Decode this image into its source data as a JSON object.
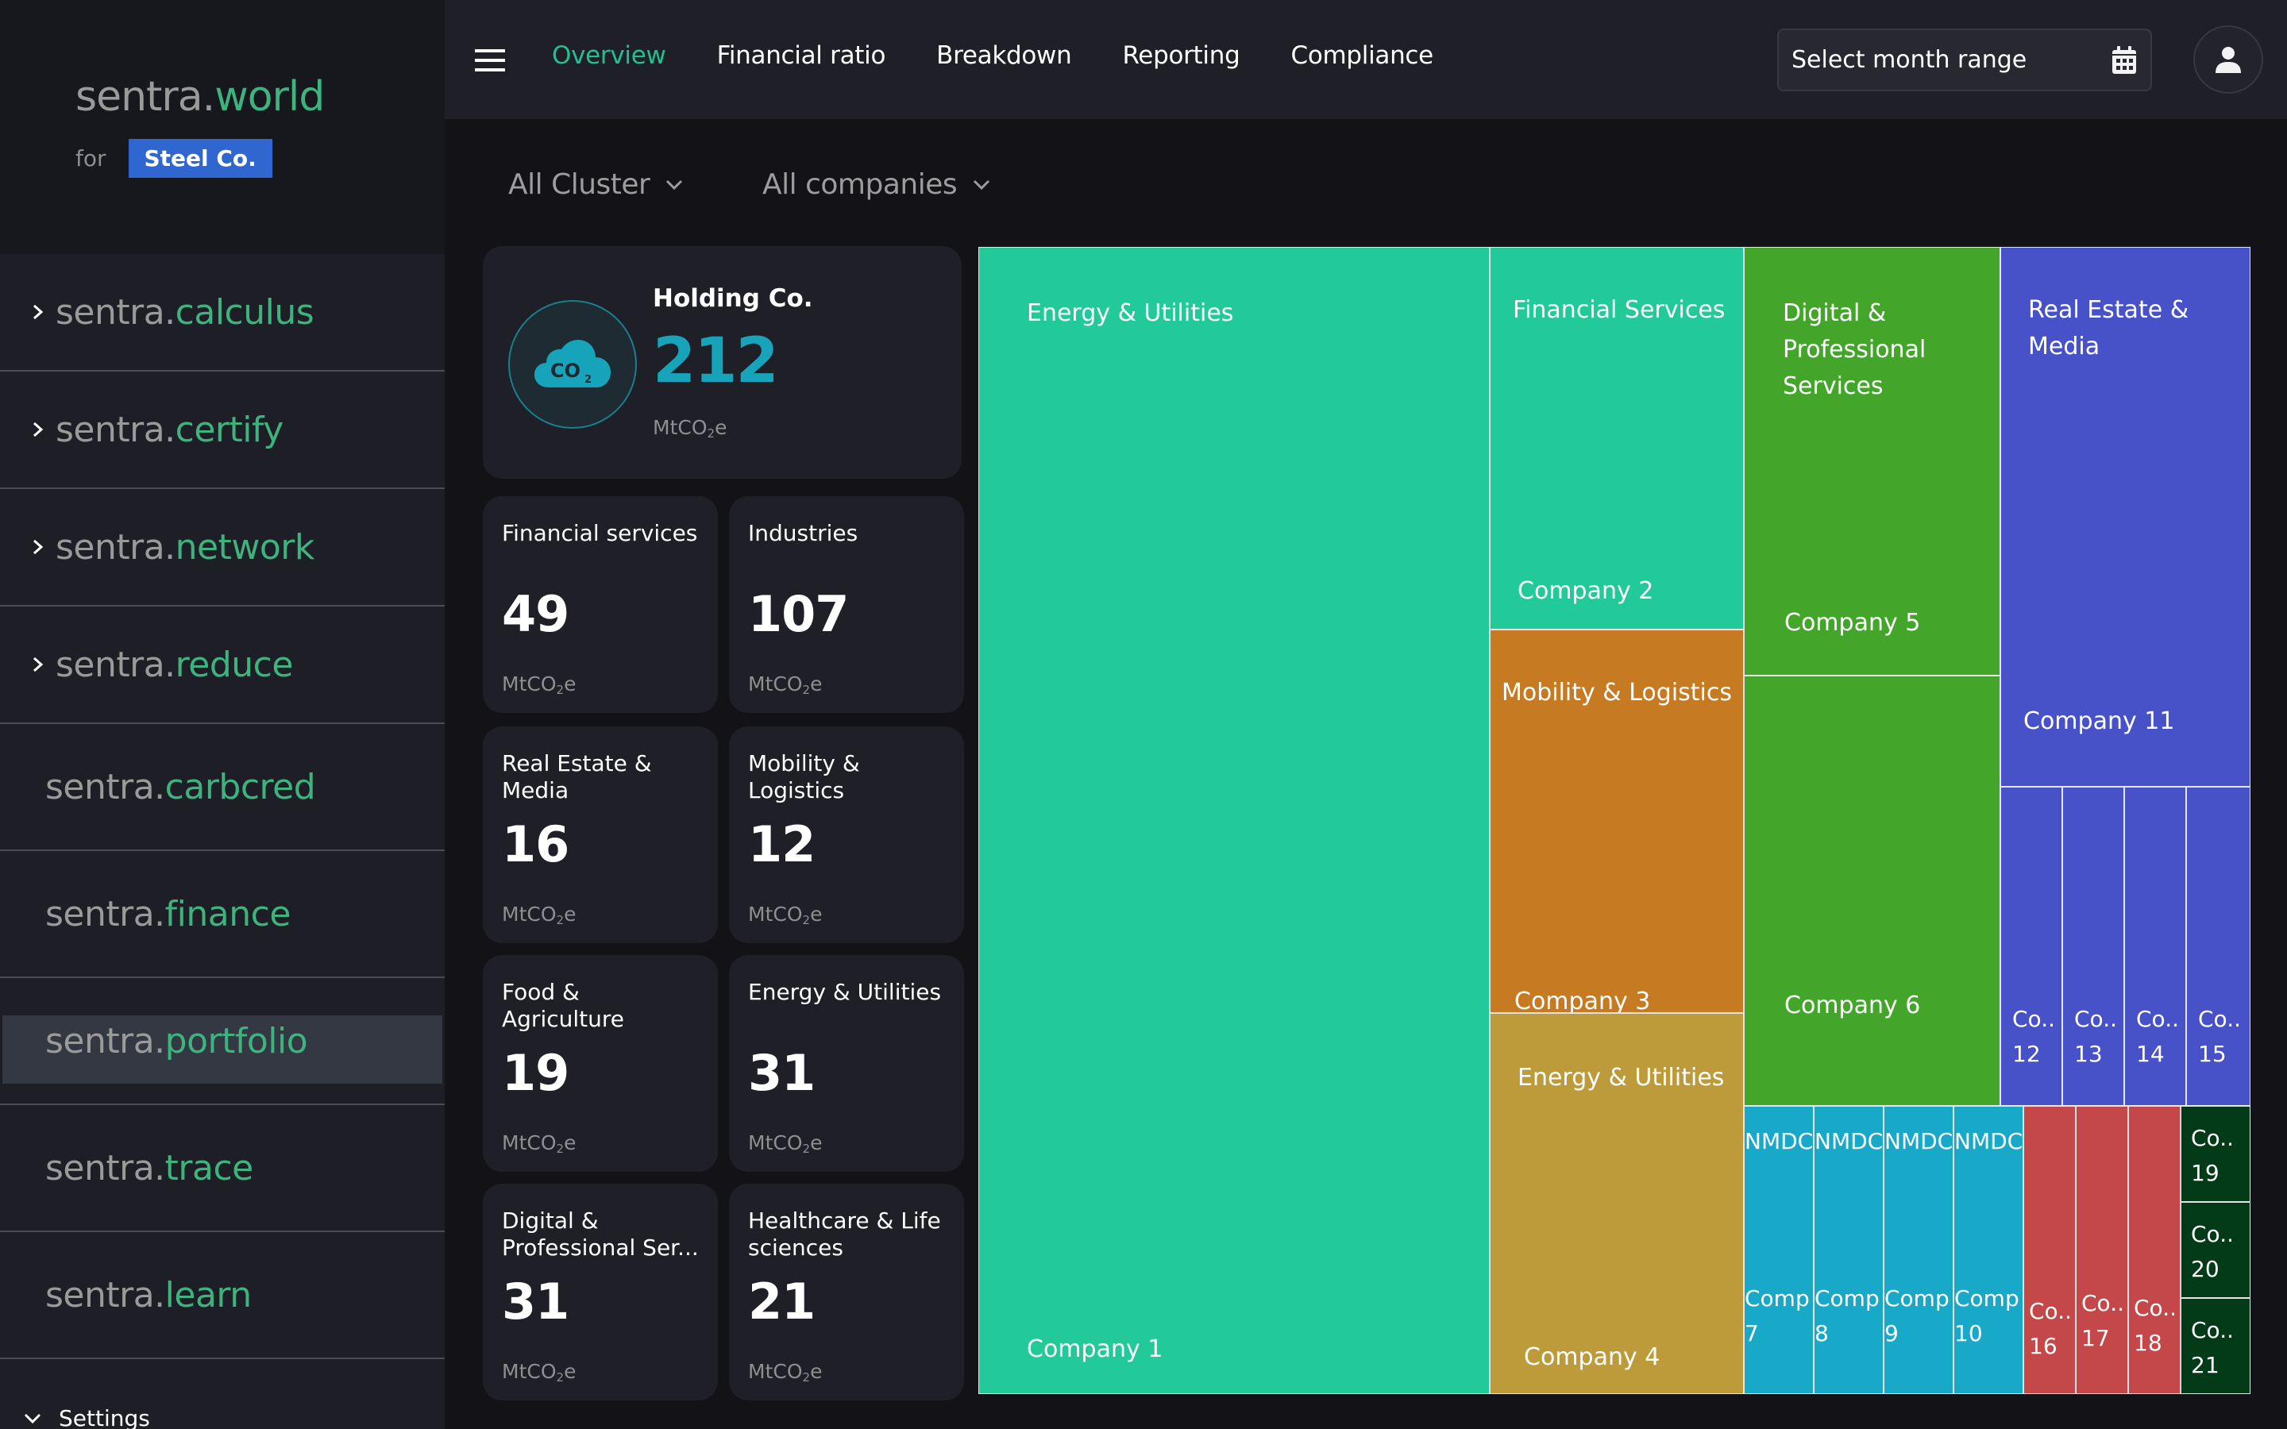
{
  "brand": {
    "prefix": "sentra.",
    "suffix": "world",
    "for_label": "for",
    "client": "Steel Co."
  },
  "sidebar": {
    "items": [
      {
        "prefix": "sentra.",
        "suffix": "calculus",
        "expandable": true
      },
      {
        "prefix": "sentra.",
        "suffix": "certify",
        "expandable": true
      },
      {
        "prefix": "sentra.",
        "suffix": "network",
        "expandable": true
      },
      {
        "prefix": "sentra.",
        "suffix": "reduce",
        "expandable": true
      },
      {
        "prefix": "sentra.",
        "suffix": "carbcred",
        "expandable": false
      },
      {
        "prefix": "sentra.",
        "suffix": "finance",
        "expandable": false
      },
      {
        "prefix": "sentra.",
        "suffix": "portfolio",
        "expandable": false,
        "active": true
      },
      {
        "prefix": "sentra.",
        "suffix": "trace",
        "expandable": false
      },
      {
        "prefix": "sentra.",
        "suffix": "learn",
        "expandable": false
      }
    ],
    "settings_label": "Settings"
  },
  "topbar": {
    "tabs": [
      {
        "label": "Overview",
        "active": true
      },
      {
        "label": "Financial ratio"
      },
      {
        "label": "Breakdown"
      },
      {
        "label": "Reporting"
      },
      {
        "label": "Compliance"
      }
    ],
    "month_range_placeholder": "Select month range",
    "icons": {
      "menu": "hamburger-icon",
      "calendar": "calendar-icon",
      "user": "user-icon"
    }
  },
  "filters": {
    "cluster": "All Cluster",
    "companies": "All companies"
  },
  "colors": {
    "accent": "#22c08f",
    "brand_green": "#3db37e",
    "client_badge": "#2f66d0",
    "holding_value": "#17a3ba"
  },
  "holding": {
    "title": "Holding Co.",
    "value": "212",
    "unit_pre": "MtCO",
    "unit_sub": "2",
    "unit_post": "e",
    "icon": "co2-cloud-icon"
  },
  "sectors": [
    {
      "name": "Financial services",
      "value": "49"
    },
    {
      "name": "Industries",
      "value": "107"
    },
    {
      "name": "Real Estate & Media",
      "value": "16"
    },
    {
      "name": "Mobility & Logistics",
      "value": "12"
    },
    {
      "name": "Food & Agriculture",
      "value": "19"
    },
    {
      "name": "Energy & Utilities",
      "value": "31"
    },
    {
      "name": "Digital & Professional Ser...",
      "value": "31"
    },
    {
      "name": "Healthcare & Life sciences",
      "value": "21"
    }
  ],
  "chart_data": {
    "type": "treemap",
    "title": "",
    "tiles": [
      {
        "sector": "Energy & Utilities",
        "company": "Company 1",
        "color": "#22c999"
      },
      {
        "sector": "Financial Services",
        "company": "Company 2",
        "color": "#22c999"
      },
      {
        "sector": "Mobility & Logistics",
        "company": "Company 3",
        "color": "#c67a22"
      },
      {
        "sector": "Energy & Utilities",
        "company": "Company 4",
        "color": "#bd9b3a"
      },
      {
        "sector": "Digital & Professional Services",
        "company": "Company 5",
        "color": "#43a62b"
      },
      {
        "sector": "",
        "company": "Company 6",
        "color": "#43a62b"
      },
      {
        "sector": "NMDC",
        "company": "Comp 7",
        "color": "#18a8c8"
      },
      {
        "sector": "NMDC",
        "company": "Comp 8",
        "color": "#18a8c8"
      },
      {
        "sector": "NMDC",
        "company": "Comp 9",
        "color": "#18a8c8"
      },
      {
        "sector": "NMDC",
        "company": "Comp 10",
        "color": "#18a8c8"
      },
      {
        "sector": "Real Estate & Media",
        "company": "Company 11",
        "color": "#4752c8"
      },
      {
        "sector": "",
        "company": "Co.. 12",
        "color": "#4752c8"
      },
      {
        "sector": "",
        "company": "Co.. 13",
        "color": "#4752c8"
      },
      {
        "sector": "",
        "company": "Co.. 14",
        "color": "#4752c8"
      },
      {
        "sector": "",
        "company": "Co.. 15",
        "color": "#4752c8"
      },
      {
        "sector": "",
        "company": "Co.. 16",
        "color": "#c4484a"
      },
      {
        "sector": "",
        "company": "Co.. 17",
        "color": "#c4484a"
      },
      {
        "sector": "",
        "company": "Co.. 18",
        "color": "#c4484a"
      },
      {
        "sector": "",
        "company": "Co.. 19",
        "color": "#033a17"
      },
      {
        "sector": "",
        "company": "Co.. 20",
        "color": "#033a17"
      },
      {
        "sector": "",
        "company": "Co.. 21",
        "color": "#033a17"
      }
    ]
  }
}
